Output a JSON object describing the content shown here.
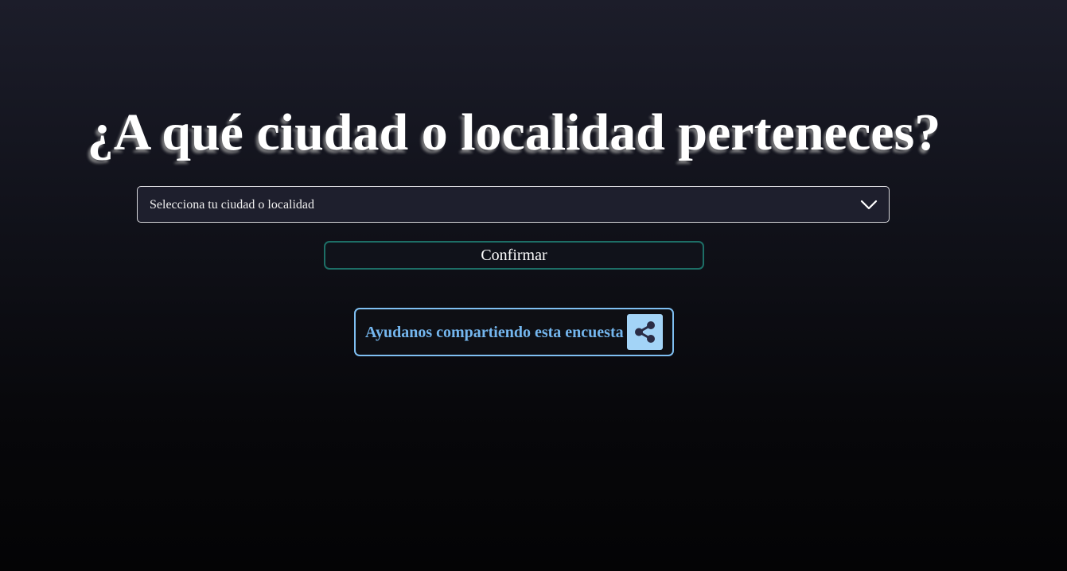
{
  "heading": "¿A qué ciudad o localidad perteneces?",
  "city_select": {
    "placeholder": "Selecciona tu ciudad o localidad",
    "icon": "chevron-down-icon"
  },
  "confirm_button": {
    "label": "Confirmar",
    "border_color": "#1d6e66"
  },
  "share_button": {
    "label": "Ayudanos compartiendo esta encuesta",
    "icon": "share-icon",
    "accent_color": "#74b6ee"
  }
}
